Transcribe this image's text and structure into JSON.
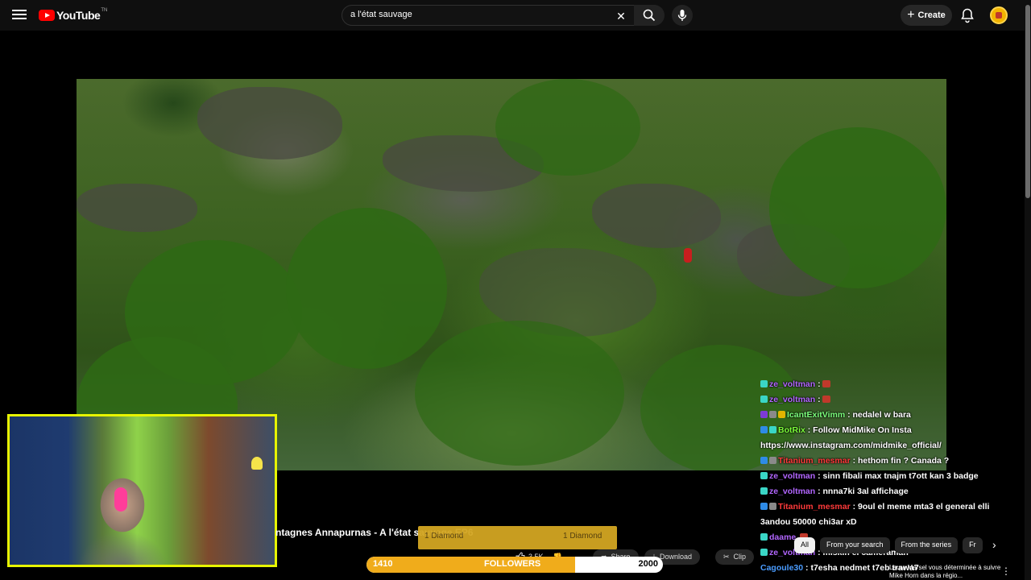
{
  "header": {
    "logo_text": "YouTube",
    "logo_sup": "TN",
    "search_value": "a l'état sauvage",
    "create_label": "Create"
  },
  "video": {
    "title_fragment": "ntagnes Annapurnas - A l'état sauvage EP6"
  },
  "overlays": {
    "goal_left": "1 Diamond",
    "goal_right": "1 Diamond",
    "followers_current": "1410",
    "followers_label": "FOLLOWERS",
    "followers_target": "2000",
    "followers_progress": 0.705
  },
  "actions": {
    "like_count": "3.5K",
    "share_label": "Share",
    "download_label": "Download",
    "clip_label": "Clip"
  },
  "chat": [
    {
      "user": "ze_voltman",
      "color": "#b266ff",
      "badges": [
        "b-teal"
      ],
      "msg": ":",
      "emote": true
    },
    {
      "user": "ze_voltman",
      "color": "#b266ff",
      "badges": [
        "b-teal"
      ],
      "msg": ":",
      "emote": true
    },
    {
      "user": "IcantExitVimm",
      "color": "#7cff7c",
      "badges": [
        "b-purple",
        "b-grey",
        "b-gold"
      ],
      "msg": ": nedalel w bara",
      "emote": false
    },
    {
      "user": "BotRix",
      "color": "#7cff3a",
      "badges": [
        "b-blue",
        "b-teal"
      ],
      "msg": ": Follow MidMike On Insta https://www.instagram.com/midmike_official/",
      "emote": false
    },
    {
      "user": "Titanium_mesmar",
      "color": "#ff3a3a",
      "badges": [
        "b-blue",
        "b-grey"
      ],
      "msg": ": hethom fin ? Canada ?",
      "emote": false
    },
    {
      "user": "ze_voltman",
      "color": "#b266ff",
      "badges": [
        "b-teal"
      ],
      "msg": ": sinn fibali max tnajm t7ott kan 3 badge",
      "emote": false
    },
    {
      "user": "ze_voltman",
      "color": "#b266ff",
      "badges": [
        "b-teal"
      ],
      "msg": ": nnna7ki 3al affichage",
      "emote": false
    },
    {
      "user": "Titanium_mesmar",
      "color": "#ff3a3a",
      "badges": [
        "b-blue",
        "b-grey"
      ],
      "msg": ": 9oul el meme mta3 el general elli 3andou 50000 chi3ar xD",
      "emote": false
    },
    {
      "user": "daame",
      "color": "#b266ff",
      "badges": [
        "b-teal"
      ],
      "msg": "",
      "emote": true
    },
    {
      "user": "ze_voltman",
      "color": "#b266ff",
      "badges": [
        "b-teal"
      ],
      "msg": ": miskin el cameraman ^^",
      "emote": false
    },
    {
      "user": "Cagoule30",
      "color": "#4a9cff",
      "badges": [],
      "msg": ": t7esha nedmet t7eb trawa7",
      "emote": false
    }
  ],
  "chips": [
    "All",
    "From your search",
    "From the series",
    "Fr"
  ],
  "side_video_title": "Laura Marsel vous déterminée à suivre Mike Horn dans la régio..."
}
